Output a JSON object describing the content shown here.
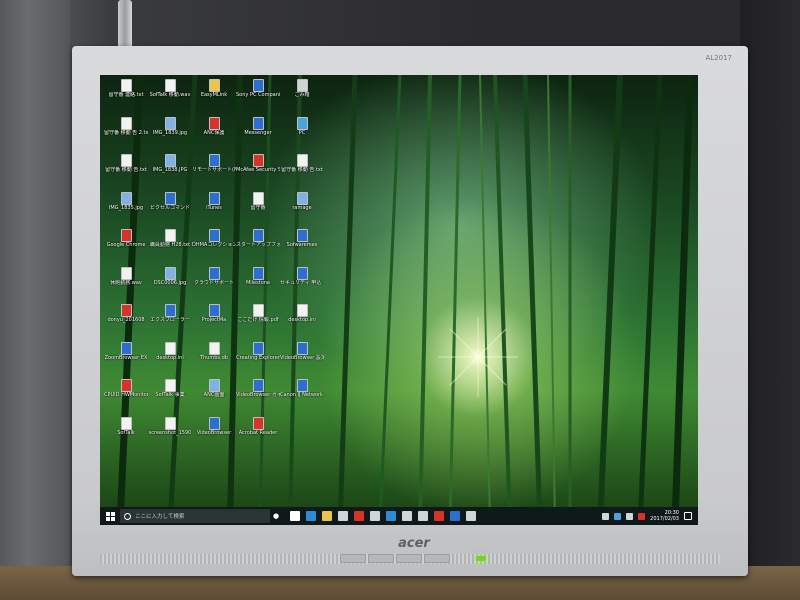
{
  "monitor": {
    "brand": "acer",
    "model": "AL2017"
  },
  "desktop": {
    "icons": [
      {
        "label": "留守番 連絡.txt",
        "kind": "doc",
        "color": "#f2f2f2"
      },
      {
        "label": "SofTalk 移動.wav",
        "kind": "doc",
        "color": "#f2f2f2"
      },
      {
        "label": "EasyMLink",
        "kind": "app",
        "color": "#e9c64a"
      },
      {
        "label": "Sony PC Companion 2",
        "kind": "app",
        "color": "#2b6fd1"
      },
      {
        "label": "ごみ箱",
        "kind": "app",
        "color": "#cfd6d7"
      },
      {
        "label": "留守番 移動 告 2.txt",
        "kind": "doc",
        "color": "#f2f2f2"
      },
      {
        "label": "IMG_1839.jpg",
        "kind": "img",
        "color": "#7fb3e6"
      },
      {
        "label": "ANC保護",
        "kind": "app",
        "color": "#d8332a"
      },
      {
        "label": "Messenger",
        "kind": "app",
        "color": "#2b6fd1"
      },
      {
        "label": "PC",
        "kind": "pc",
        "color": "#4aa3df"
      },
      {
        "label": "留守番 移動 告.txt",
        "kind": "doc",
        "color": "#f2f2f2"
      },
      {
        "label": "IMG_1838.JPG",
        "kind": "img",
        "color": "#7fb3e6"
      },
      {
        "label": "リモートサポート(NTT)",
        "kind": "app",
        "color": "#2b6fd1"
      },
      {
        "label": "McAfee Security Scan Plus",
        "kind": "app",
        "color": "#d8332a"
      },
      {
        "label": "留守番 移動 告.txt",
        "kind": "doc",
        "color": "#f2f2f2"
      },
      {
        "label": "IMG_1835.jpg",
        "kind": "img",
        "color": "#7fb3e6"
      },
      {
        "label": "ピクセルコマンド",
        "kind": "app",
        "color": "#2b6fd1"
      },
      {
        "label": "iTunes",
        "kind": "app",
        "color": "#2b6fd1"
      },
      {
        "label": "留守番",
        "kind": "doc",
        "color": "#f2f2f2"
      },
      {
        "label": "ramage",
        "kind": "img",
        "color": "#7fb3e6"
      },
      {
        "label": "Google Chrome",
        "kind": "app",
        "color": "#d8332a"
      },
      {
        "label": "職員勤務 H28.txt",
        "kind": "doc",
        "color": "#f2f2f2"
      },
      {
        "label": "DHMAコレクション",
        "kind": "app",
        "color": "#2b6fd1"
      },
      {
        "label": "スタートアップフォルダ",
        "kind": "app",
        "color": "#2b6fd1"
      },
      {
        "label": "Sofwaremes",
        "kind": "app",
        "color": "#2b6fd1"
      },
      {
        "label": "休館勤務.wav",
        "kind": "doc",
        "color": "#f2f2f2"
      },
      {
        "label": "DSC0006.jpg",
        "kind": "img",
        "color": "#7fb3e6"
      },
      {
        "label": "クラウドサポート",
        "kind": "app",
        "color": "#2b6fd1"
      },
      {
        "label": "Milestone",
        "kind": "app",
        "color": "#2b6fd1"
      },
      {
        "label": "セキュリティ 申込 セール",
        "kind": "app",
        "color": "#2b6fd1"
      },
      {
        "label": "donyu_201608",
        "kind": "img",
        "color": "#d8332a"
      },
      {
        "label": "エクスプローラー",
        "kind": "app",
        "color": "#2b6fd1"
      },
      {
        "label": "ProjectMa",
        "kind": "app",
        "color": "#2b6fd1"
      },
      {
        "label": "ここだけ 情報.pdf",
        "kind": "doc",
        "color": "#f2f2f2"
      },
      {
        "label": "desktop.ini",
        "kind": "doc",
        "color": "#f2f2f2"
      },
      {
        "label": "ZoomBrowser EX",
        "kind": "app",
        "color": "#2b6fd1"
      },
      {
        "label": "desktop.ini",
        "kind": "doc",
        "color": "#f2f2f2"
      },
      {
        "label": "Thumbs.db",
        "kind": "doc",
        "color": "#f2f2f2"
      },
      {
        "label": "Creating Explorer",
        "kind": "app",
        "color": "#2b6fd1"
      },
      {
        "label": "VideoBrowser 設定",
        "kind": "app",
        "color": "#2b6fd1"
      },
      {
        "label": "CPUID HWMonitor",
        "kind": "app",
        "color": "#d8332a"
      },
      {
        "label": "SofTalk 事業",
        "kind": "doc",
        "color": "#f2f2f2"
      },
      {
        "label": "ANC画面",
        "kind": "img",
        "color": "#7fb3e6"
      },
      {
        "label": "VideoBrowser ガイド",
        "kind": "app",
        "color": "#2b6fd1"
      },
      {
        "label": "Canon IJ Network Tool",
        "kind": "app",
        "color": "#2b6fd1"
      },
      {
        "label": "SofTalk",
        "kind": "doc",
        "color": "#f2f2f2"
      },
      {
        "label": "screenshot_1590",
        "kind": "doc",
        "color": "#f2f2f2"
      },
      {
        "label": "VideoBrowser",
        "kind": "app",
        "color": "#2b6fd1"
      },
      {
        "label": "Acrobat Reader",
        "kind": "app",
        "color": "#d8332a"
      }
    ]
  },
  "taskbar": {
    "search_placeholder": "ここに入力して検索",
    "mic_icon": "microphone-icon",
    "apps": [
      {
        "name": "task-view",
        "color": "#ffffff"
      },
      {
        "name": "edge",
        "color": "#2f8bd6"
      },
      {
        "name": "explorer",
        "color": "#e9c64a"
      },
      {
        "name": "store",
        "color": "#cfd6d7"
      },
      {
        "name": "chrome",
        "color": "#d8332a"
      },
      {
        "name": "mail",
        "color": "#cfd6d7"
      },
      {
        "name": "ie",
        "color": "#2f8bd6"
      },
      {
        "name": "photos",
        "color": "#cfd6d7"
      },
      {
        "name": "settings",
        "color": "#cfd6d7"
      },
      {
        "name": "acrobat",
        "color": "#d8332a"
      },
      {
        "name": "word",
        "color": "#2b6fd1"
      },
      {
        "name": "onedrive",
        "color": "#cfd6d7"
      }
    ],
    "clock_time": "20:30",
    "clock_date": "2017/02/03"
  }
}
